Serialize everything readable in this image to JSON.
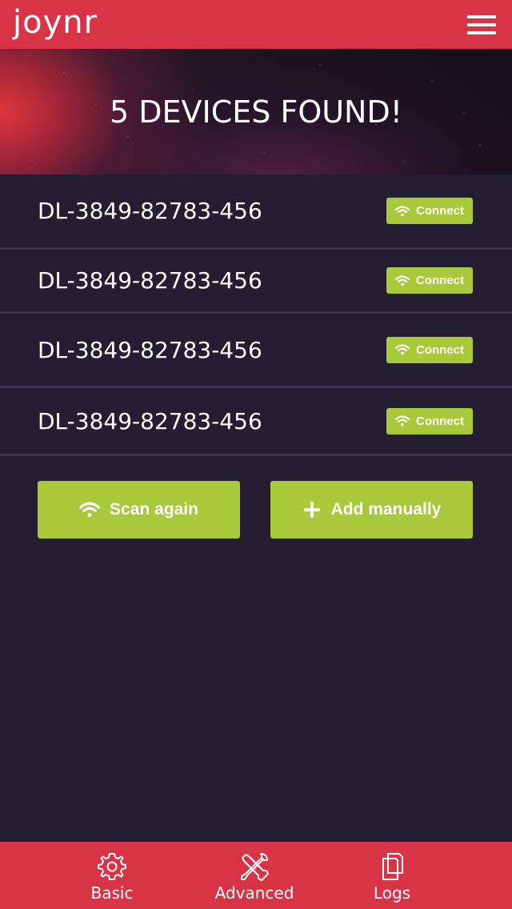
{
  "app": {
    "logo": "joynr",
    "menu_icon": "hamburger-menu-icon"
  },
  "hero": {
    "title": "5 DEVICES FOUND!"
  },
  "devices": [
    {
      "name": "DL-3849-82783-456",
      "action": "Connect"
    },
    {
      "name": "DL-3849-82783-456",
      "action": "Connect"
    },
    {
      "name": "DL-3849-82783-456",
      "action": "Connect"
    },
    {
      "name": "DL-3849-82783-456",
      "action": "Connect"
    }
  ],
  "actions": {
    "scan_label": "Scan again",
    "add_label": "Add manually"
  },
  "nav": {
    "items": [
      {
        "label": "Basic",
        "icon": "gear-icon"
      },
      {
        "label": "Advanced",
        "icon": "tools-icon"
      },
      {
        "label": "Logs",
        "icon": "copy-icon"
      }
    ]
  },
  "colors": {
    "header": "#d83446",
    "background": "#231e31",
    "accent_green": "#a8c93a",
    "divider": "#3a3350"
  }
}
